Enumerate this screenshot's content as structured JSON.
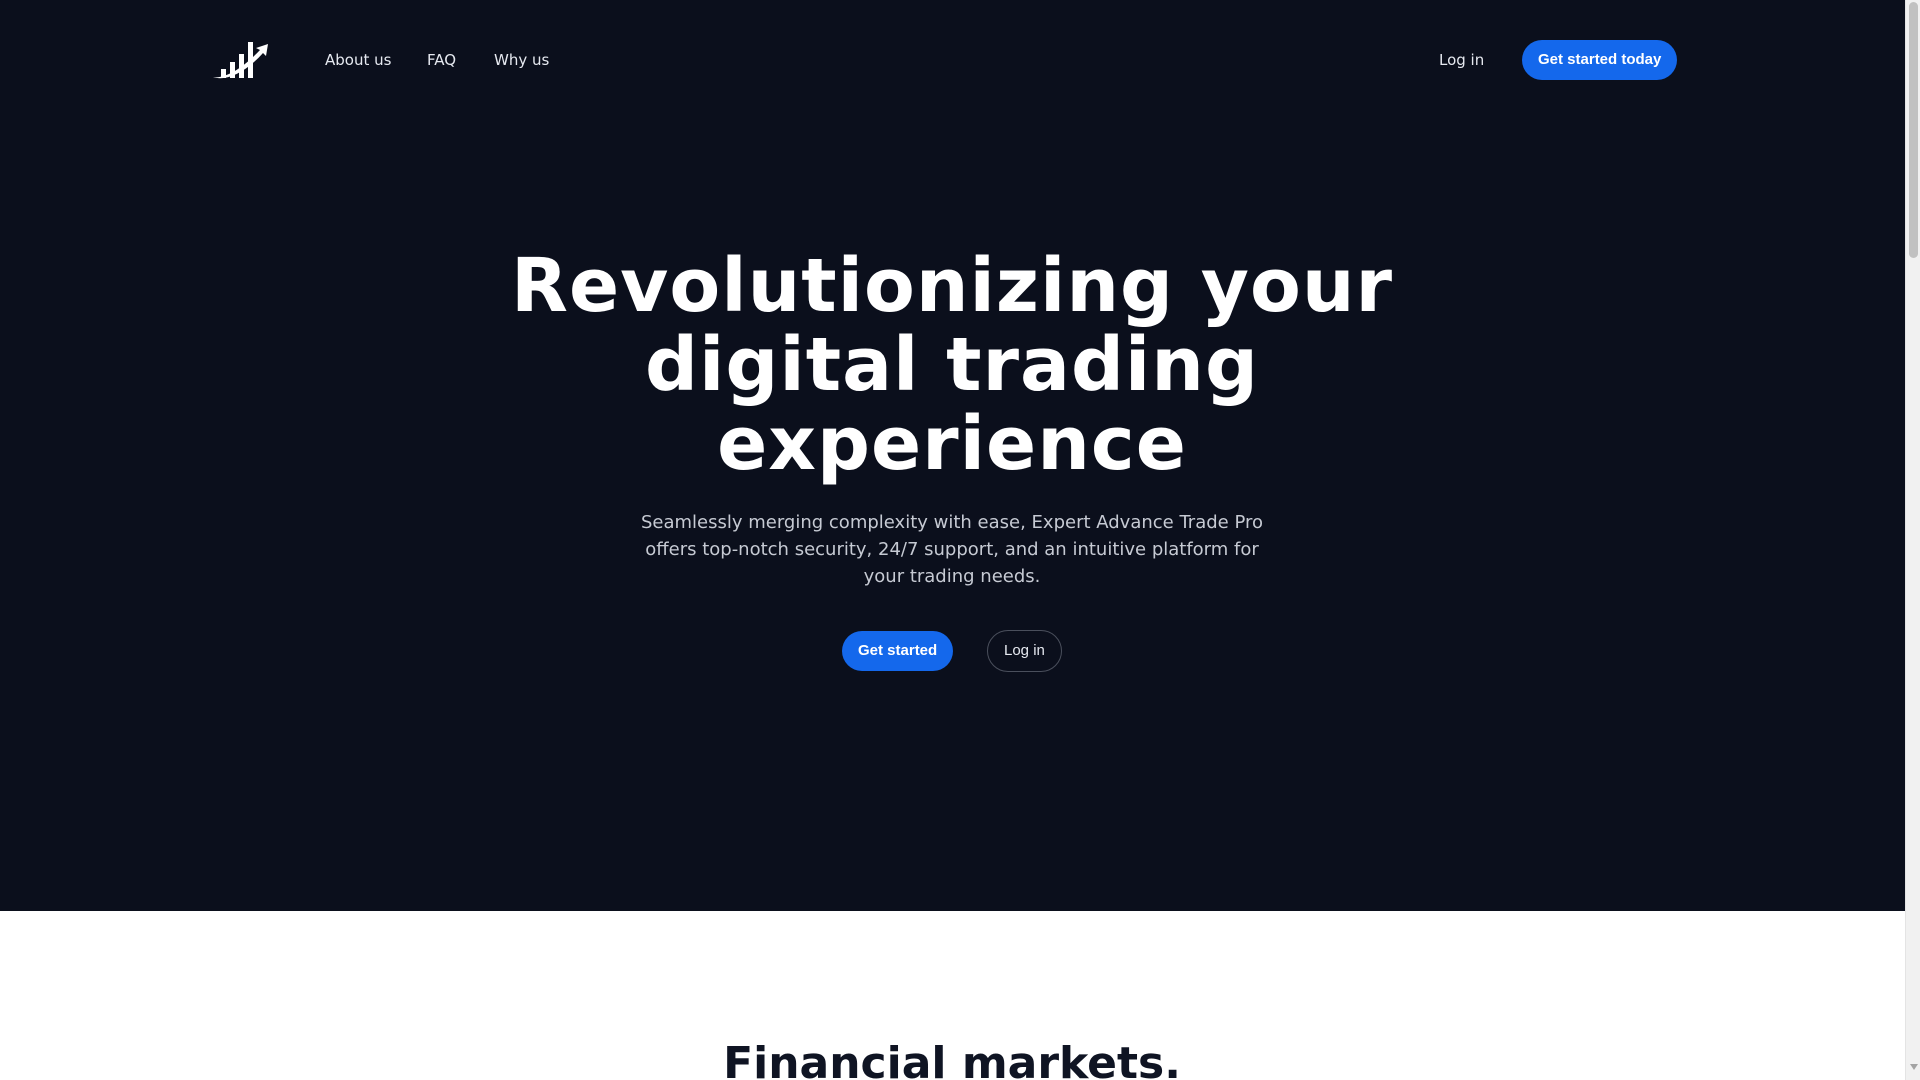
{
  "header": {
    "logo_icon": "rising-chart-swoosh-icon",
    "nav": {
      "about": "About us",
      "faq": "FAQ",
      "why": "Why us"
    },
    "login": "Log in",
    "cta": "Get started today"
  },
  "hero": {
    "title": "Revolutionizing your digital trading experience",
    "subtitle": "Seamlessly merging complexity with ease, Expert Advance Trade Pro offers top-notch security, 24/7 support, and an intuitive platform for your trading needs.",
    "primary_button": "Get started",
    "secondary_button": "Log in"
  },
  "next_section": {
    "title": "Financial markets."
  },
  "colors": {
    "hero_background": "#0b0f1c",
    "accent": "#1468ec",
    "page_background": "#ffffff"
  }
}
